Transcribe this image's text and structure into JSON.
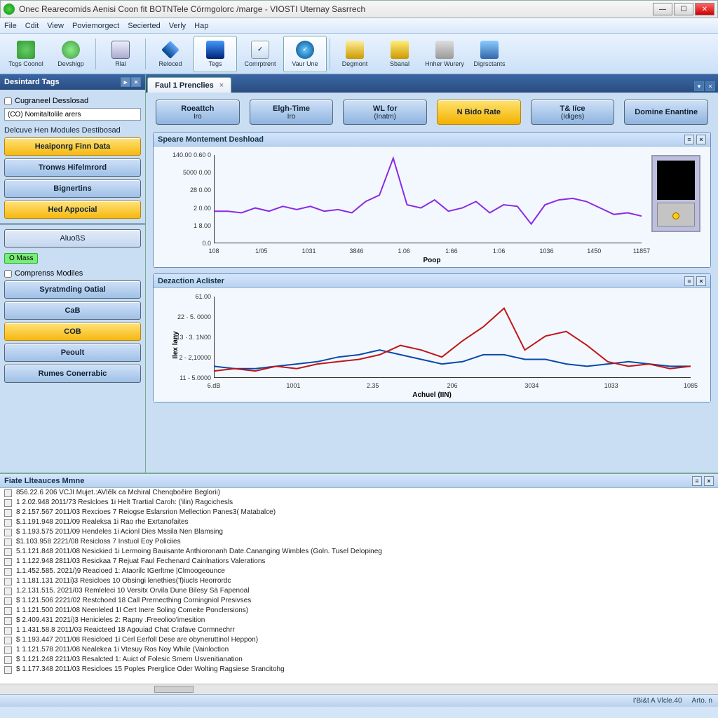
{
  "window": {
    "title": "Onec Rearecomids Aenisi Coon fit BOTNTele Cörmgolorc /marge - VIOSTI Uternay Sasrrech"
  },
  "menu": [
    "File",
    "Cdit",
    "View",
    "Poviemorgect",
    "Secierted",
    "Verly",
    "Hap"
  ],
  "toolbar": [
    {
      "label": "Tcgs Coonol",
      "icon": "gear"
    },
    {
      "label": "Devshigp",
      "icon": "disc"
    },
    {
      "label": "Rlal",
      "icon": "doc"
    },
    {
      "label": "Reloced",
      "icon": "diam"
    },
    {
      "label": "Tegs",
      "icon": "mon",
      "active": true
    },
    {
      "label": "Comrptrent",
      "icon": "chk"
    },
    {
      "label": "Vaur Une",
      "icon": "ok",
      "active": true
    },
    {
      "label": "Degmont",
      "icon": "wiz"
    },
    {
      "label": "Sbanal",
      "icon": "fold"
    },
    {
      "label": "Hnher Wurery",
      "icon": "comp"
    },
    {
      "label": "Digrsctants",
      "icon": "grid"
    }
  ],
  "sidebar": {
    "title": "Desintard Tags",
    "group1": {
      "check_label": "Cugraneel Desslosad",
      "input_value": "(CO) Nomitaltolile arers",
      "sub_label": "Delcuve Hen Modules Destibosad"
    },
    "btns1": [
      {
        "label": "Heaiponrg Finn Data",
        "gold": true
      },
      {
        "label": "Tronws Hifelmrord"
      },
      {
        "label": "Bignertins"
      },
      {
        "label": "Hed Appocial",
        "gold": true
      }
    ],
    "mid_btn": "AluoßS",
    "badge": "O Mass",
    "group2_label": "Comprenss Modiles",
    "btns2": [
      {
        "label": "Syratmding Oatial"
      },
      {
        "label": "CaB"
      },
      {
        "label": "COB",
        "gold": true
      },
      {
        "label": "Peoult"
      },
      {
        "label": "Rumes Conerrabic"
      }
    ]
  },
  "tab": {
    "label": "Faul 1 Prenclies"
  },
  "big_buttons": [
    {
      "line1": "Roeattch",
      "line2": "Iro"
    },
    {
      "line1": "Elgh-Time",
      "line2": "Iro"
    },
    {
      "line1": "WL for",
      "line2": "(Inatm)"
    },
    {
      "line1": "N Bido Rate",
      "line2": "",
      "gold": true
    },
    {
      "line1": "T& Iíce",
      "line2": "(Idiges)"
    },
    {
      "line1": "Domine Enantine",
      "line2": ""
    }
  ],
  "panel1": {
    "title": "Speare Montement Deshload",
    "xlabel": "Poop"
  },
  "panel2": {
    "title": "Dezaction Aclister",
    "xlabel": "Achuel (IIN)",
    "ylabel": "Ilex lany"
  },
  "messages": {
    "title": "Fiate Llteauces Mmne",
    "rows": [
      {
        "ts": "856.22.6 206",
        "yr": "",
        "id": "VCJI Mujet.:AVlêlk ca   Mchiral Chenqboêire Beglorii)"
      },
      {
        "ts": "1 2.02.948",
        "yr": "2011/73",
        "id": "Reslcloes 1i   Helt Trartial Caroh: ('ilin) Ragcichesls"
      },
      {
        "ts": "8 2.157.567",
        "yr": "2011/03",
        "id": "Rexcioes 7   Reiogse Eslarsrion Mellection Panes3( Matabalce)"
      },
      {
        "ts": "$.1.191.948",
        "yr": "2011/09",
        "id": "Realeksa 1i   Rao rhe Exrtanofaites"
      },
      {
        "ts": "$ 1.193.575",
        "yr": "2011/09",
        "id": "Hendeles 1i   Acionl Dies Mssila Nen Blamsing"
      },
      {
        "ts": "$1.103.958",
        "yr": "2221/08",
        "id": "Resicloss 7   Instuol Eoy Policiies"
      },
      {
        "ts": "5.1.121.848",
        "yr": "2011/08",
        "id": "Nesickied 1i   Lermoing Bauisante Anthioronanh Date.Cananging Wimbles (Goln. Tusel Delopineg"
      },
      {
        "ts": "1 1.122.948",
        "yr": "2811/03",
        "id": "Resickaa 7   Rejuat Faul Fechenard Cainlnatiors Valerations"
      },
      {
        "ts": "1.1.452.585.",
        "yr": "2021/)9",
        "id": "Reacioed 1:   Ataorilc IGerltme |Clmoogeounce"
      },
      {
        "ts": "1 1.181.131",
        "yr": "2011i)3",
        "id": "Resicloes 10  Obsingi lenethies('f)iucls Heorrordc"
      },
      {
        "ts": "1.2.131.515.",
        "yr": "2021/03",
        "id": "Remleleci 10  Versitx Orvila Dune Bilesy Sä Fapenoal"
      },
      {
        "ts": "$ 1.121.506",
        "yr": "2221/02",
        "id": "Restchoed 18  Call Prernecthing Corningniol Presivses"
      },
      {
        "ts": "1 1.121.500",
        "yr": "2011/08",
        "id": "Neenleled 1I   Cert Inere Soling Comeite Ponclersions)"
      },
      {
        "ts": "$ 2.409.431",
        "yr": "2021i)3",
        "id": "Henicieles 2:  Rapny .Freeolioo'imesition"
      },
      {
        "ts": "1 1.431.58.8",
        "yr": "2011/03",
        "id": "Reaicteed 18  Agouiad Chat Crafave Cormnechrr"
      },
      {
        "ts": "$ 1.193.447",
        "yr": "2011/08",
        "id": "Resicloed 1i   Cerl Eerfoll Dese are obyneruttinol Heppon)"
      },
      {
        "ts": "1 1.121.578",
        "yr": "2011/08",
        "id": "Nealekea 1i   Vtesuy Ros Noy While (Vainloction"
      },
      {
        "ts": "$ 1.121.248",
        "yr": "2211/03",
        "id": "Resalcted 1:   Auict of Folesic Smern Usvenitianation"
      },
      {
        "ts": "$ 1.177.348",
        "yr": "2011/03",
        "id": "Resicloes 15  Poples Prerglice Oder Wolting Ragsiese Srancitohg"
      }
    ]
  },
  "status": {
    "left": "I'Bi&t A Vlcle.40",
    "right": "Arto. n"
  },
  "chart_data": [
    {
      "type": "line",
      "title": "Speare Montement Deshload",
      "xlabel": "Poop",
      "yticks": [
        "140.00 0.60 0",
        "5000 0.00",
        "28 0.00",
        "2 0.00",
        "1 8.00",
        "0.0"
      ],
      "xticks": [
        "108",
        "1/05",
        "1031",
        "3846",
        "1.06",
        "1:66",
        "1:06",
        "1036",
        "1450",
        "11857"
      ],
      "series": [
        {
          "name": "main",
          "color": "#8a2be2",
          "values": [
            20,
            20,
            19,
            22,
            20,
            23,
            21,
            23,
            20,
            21,
            19,
            26,
            30,
            53,
            24,
            22,
            27,
            20,
            22,
            26,
            19,
            24,
            23,
            12,
            24,
            27,
            28,
            26,
            22,
            18,
            19,
            17
          ]
        }
      ],
      "ylim": [
        0,
        55
      ]
    },
    {
      "type": "line",
      "title": "Dezaction Aclister",
      "xlabel": "Achuel (IIN)",
      "ylabel": "Ilex lany",
      "yticks": [
        "61.00",
        "22 · 5. 0000",
        "13 · 3. 1N00",
        "2 - 2,10000",
        "11 - 5.0000"
      ],
      "xticks": [
        "6.dB",
        "1001",
        "2.35",
        "206",
        "3034",
        "1033",
        "1085"
      ],
      "series": [
        {
          "name": "blue",
          "color": "#0a4aa8",
          "values": [
            15,
            14,
            14,
            15,
            16,
            17,
            19,
            20,
            22,
            20,
            18,
            16,
            17,
            20,
            20,
            18,
            18,
            16,
            15,
            16,
            17,
            16,
            15,
            15
          ]
        },
        {
          "name": "red",
          "color": "#c01515",
          "values": [
            13,
            14,
            13,
            15,
            14,
            16,
            17,
            18,
            20,
            24,
            22,
            19,
            26,
            32,
            40,
            22,
            28,
            30,
            24,
            17,
            15,
            16,
            14,
            15
          ]
        }
      ],
      "ylim": [
        10,
        45
      ]
    }
  ]
}
